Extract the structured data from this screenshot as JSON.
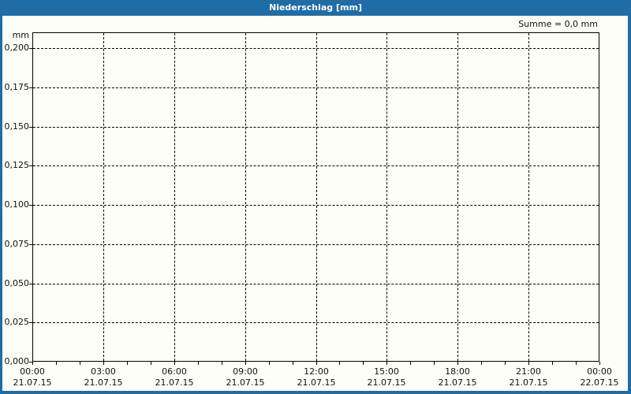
{
  "header": {
    "title": "Niederschlag [mm]"
  },
  "annotation": {
    "text": "Summe = 0,0 mm"
  },
  "colors": {
    "frame_and_header_blue": "#1F6CA6",
    "header_text": "#FFFFFF",
    "axis_grid_black": "#000000",
    "label_text": "#101010",
    "background": "#FEFEF9"
  },
  "chart_data": {
    "type": "line",
    "title": "Niederschlag [mm]",
    "ylabel": "mm",
    "xlabel": "",
    "annotation": "Summe = 0,0 mm",
    "sum": "0,0 mm",
    "grid": true,
    "legend_position": "none",
    "ylim": [
      0,
      0.21
    ],
    "y_ticks": [
      "0,000",
      "0,025",
      "0,050",
      "0,075",
      "0,100",
      "0,125",
      "0,150",
      "0,175",
      "0,200"
    ],
    "x_range_hours": 24,
    "x_ticks": [
      {
        "time": "00:00",
        "date": "21.07.15"
      },
      {
        "time": "03:00",
        "date": "21.07.15"
      },
      {
        "time": "06:00",
        "date": "21.07.15"
      },
      {
        "time": "09:00",
        "date": "21.07.15"
      },
      {
        "time": "12:00",
        "date": "21.07.15"
      },
      {
        "time": "15:00",
        "date": "21.07.15"
      },
      {
        "time": "18:00",
        "date": "21.07.15"
      },
      {
        "time": "21:00",
        "date": "21.07.15"
      },
      {
        "time": "00:00",
        "date": "22.07.15"
      }
    ],
    "series": [
      {
        "name": "Niederschlag",
        "values": [],
        "note": "no precipitation plotted; chart area is empty, total = 0,0 mm"
      }
    ]
  }
}
